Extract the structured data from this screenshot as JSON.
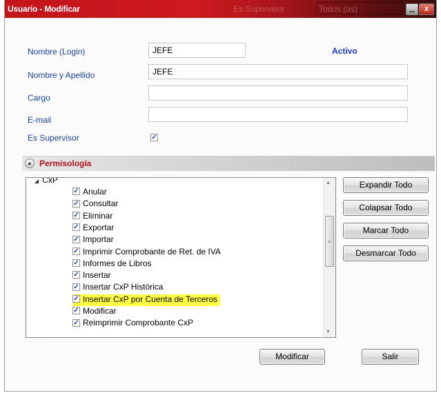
{
  "window": {
    "title": "Usuario - Modificar",
    "ghost_label": "Es Supervisor",
    "ghost_value": "Todos (as)",
    "minimize": "",
    "close": "x"
  },
  "form": {
    "login_label": "Nombre (Login)",
    "login_value": "JEFE",
    "status": "Activo",
    "fullname_label": "Nombre y Apellido",
    "fullname_value": "JEFE",
    "cargo_label": "Cargo",
    "cargo_value": "",
    "email_label": "E-mail",
    "email_value": "",
    "supervisor_label": "Es Supervisor",
    "supervisor_checked": true
  },
  "permissions": {
    "section_label": "Permisología",
    "root_node": "CxP",
    "items": [
      {
        "label": "Anular",
        "checked": true
      },
      {
        "label": "Consultar",
        "checked": true
      },
      {
        "label": "Eliminar",
        "checked": true
      },
      {
        "label": "Exportar",
        "checked": true
      },
      {
        "label": "Importar",
        "checked": true
      },
      {
        "label": "Imprimir Comprobante de Ret. de IVA",
        "checked": true
      },
      {
        "label": "Informes de Libros",
        "checked": true
      },
      {
        "label": "Insertar",
        "checked": true
      },
      {
        "label": "Insertar CxP Histórica",
        "checked": true
      },
      {
        "label": "Insertar CxP por Cuenta de Terceros",
        "checked": true,
        "highlighted": true
      },
      {
        "label": "Modificar",
        "checked": true
      },
      {
        "label": "Reimprimir Comprobante CxP",
        "checked": true
      }
    ],
    "expand_all": "Expandir Todo",
    "collapse_all": "Colapsar Todo",
    "check_all": "Marcar Todo",
    "uncheck_all": "Desmarcar Todo"
  },
  "footer": {
    "modify": "Modificar",
    "exit": "Salir"
  },
  "colors": {
    "title_bar": "#c3141b",
    "label_blue": "#1b3f9a",
    "section_red": "#b5131a",
    "highlight": "#ffff44"
  }
}
